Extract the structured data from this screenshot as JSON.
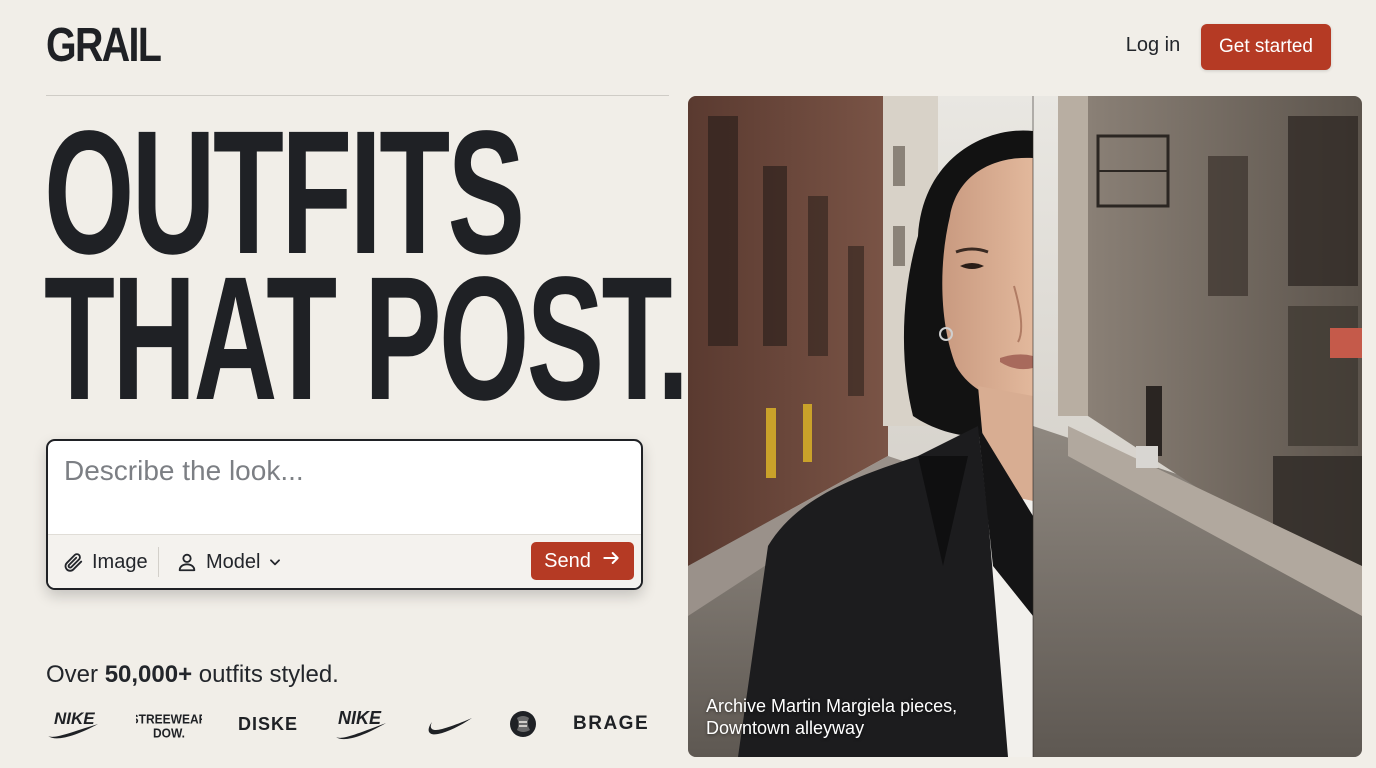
{
  "header": {
    "logo": "GRAIL",
    "login_label": "Log in",
    "cta_label": "Get started"
  },
  "hero": {
    "headline_line1": "OUTFITS",
    "headline_line2": "THAT POST."
  },
  "prompt": {
    "placeholder": "Describe the look...",
    "image_label": "Image",
    "model_label": "Model",
    "send_label": "Send",
    "icons": {
      "image": "paperclip-icon",
      "model": "person-icon",
      "dropdown": "chevron-down-icon",
      "send": "arrow-right-icon"
    }
  },
  "social_proof": {
    "prefix": "Over",
    "count": "50,000+",
    "suffix": "outfits styled."
  },
  "brands": [
    {
      "name": "NIKE",
      "style": "swoosh-wordmark"
    },
    {
      "name": "STREEWEAR DOW.",
      "style": "stacked"
    },
    {
      "name": "DISKE",
      "style": "wordmark"
    },
    {
      "name": "NIKE",
      "style": "swoosh-wordmark"
    },
    {
      "name": "",
      "style": "swoosh"
    },
    {
      "name": "",
      "style": "emblem"
    },
    {
      "name": "BRAGE",
      "style": "wordmark"
    }
  ],
  "photo": {
    "caption_line1": "Archive Martin Margiela pieces,",
    "caption_line2": "Downtown alleyway"
  },
  "colors": {
    "background": "#f1eee8",
    "accent": "#b53a24",
    "text": "#1f2125"
  }
}
